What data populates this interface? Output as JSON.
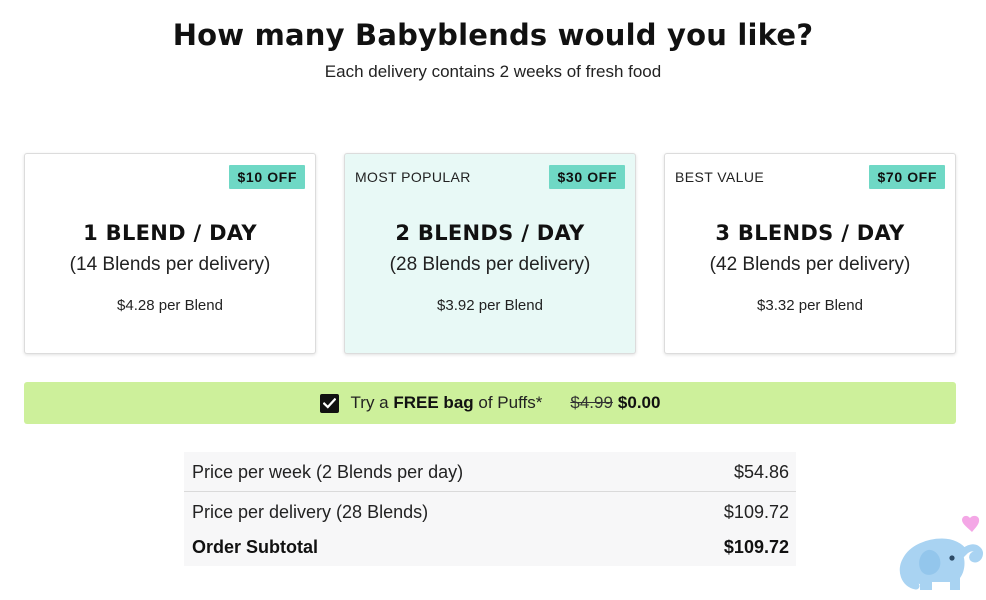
{
  "header": {
    "title": "How many Babyblends would you like?",
    "subtitle": "Each delivery contains 2 weeks of fresh food"
  },
  "plans": [
    {
      "tag": "",
      "badge": "$10 OFF",
      "title": "1 BLEND / DAY",
      "subtitle": "(14 Blends per delivery)",
      "price_per": "$4.28 per Blend"
    },
    {
      "tag": "MOST POPULAR",
      "badge": "$30 OFF",
      "title": "2 BLENDS / DAY",
      "subtitle": "(28 Blends per delivery)",
      "price_per": "$3.92 per Blend",
      "selected": true
    },
    {
      "tag": "BEST VALUE",
      "badge": "$70 OFF",
      "title": "3 BLENDS / DAY",
      "subtitle": "(42 Blends per delivery)",
      "price_per": "$3.32 per Blend"
    }
  ],
  "puffs": {
    "checked": true,
    "prefix": "Try a",
    "bold": "FREE bag",
    "suffix": "of Puffs*",
    "old_price": "$4.99",
    "new_price": "$0.00"
  },
  "summary": {
    "rows": [
      {
        "label": "Price per week (2 Blends per day)",
        "value": "$54.86"
      },
      {
        "label": "Price per delivery (28 Blends)",
        "value": "$109.72"
      },
      {
        "label": "Order Subtotal",
        "value": "$109.72"
      }
    ]
  },
  "colors": {
    "badge": "#6fd8c5",
    "selected_card": "#e8f9f6",
    "puffs_bar": "#cdf09b",
    "mascot_body": "#a9d3f2",
    "heart": "#f4a7e6"
  },
  "icons": {
    "checkbox": "check-icon",
    "mascot": "elephant-icon",
    "heart": "heart-icon"
  }
}
